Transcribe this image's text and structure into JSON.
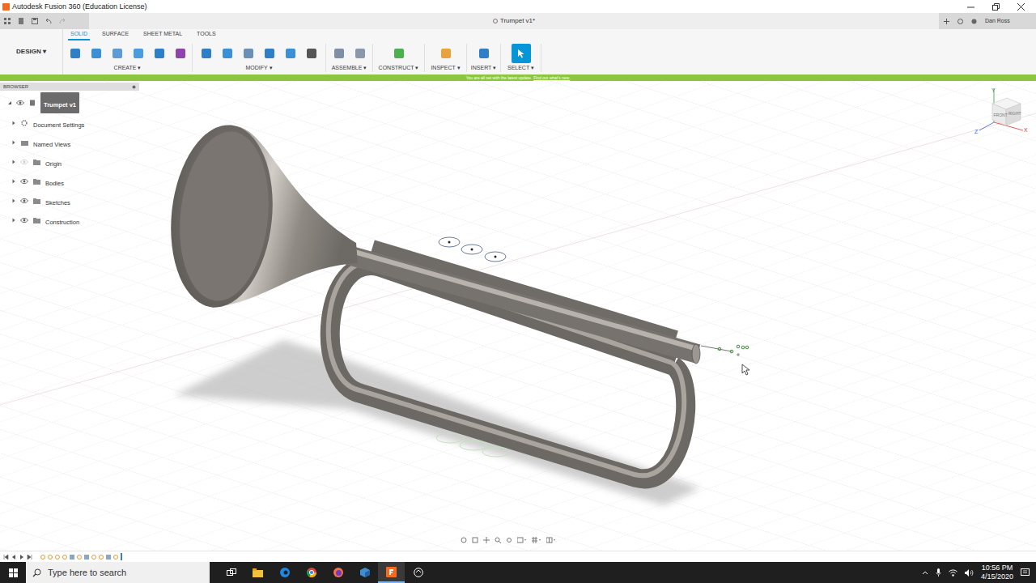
{
  "window": {
    "title": "Autodesk Fusion 360 (Education License)"
  },
  "document_tab": {
    "title": "Trumpet v1*"
  },
  "user": {
    "name": "Dan Ross"
  },
  "workspace": {
    "label": "DESIGN ▾"
  },
  "toolbar_tabs": [
    {
      "label": "SOLID",
      "selected": true
    },
    {
      "label": "SURFACE",
      "selected": false
    },
    {
      "label": "SHEET METAL",
      "selected": false
    },
    {
      "label": "TOOLS",
      "selected": false
    }
  ],
  "tool_groups": [
    {
      "label": "CREATE ▾",
      "active": false
    },
    {
      "label": "MODIFY ▾",
      "active": false
    },
    {
      "label": "ASSEMBLE ▾",
      "active": false
    },
    {
      "label": "CONSTRUCT ▾",
      "active": false
    },
    {
      "label": "INSPECT ▾",
      "active": false
    },
    {
      "label": "INSERT ▾",
      "active": false
    },
    {
      "label": "SELECT ▾",
      "active": true
    }
  ],
  "banner": {
    "text": "You are all set with the latest update.",
    "link": "Find out what's new."
  },
  "browser": {
    "title": "BROWSER",
    "items": [
      {
        "label": "Trumpet v1",
        "kind": "component",
        "expanded": true,
        "selected": true,
        "visible": true
      },
      {
        "label": "Document Settings",
        "kind": "settings",
        "expanded": false,
        "selected": false,
        "visible": true
      },
      {
        "label": "Named Views",
        "kind": "views",
        "expanded": false,
        "selected": false,
        "visible": true
      },
      {
        "label": "Origin",
        "kind": "folder",
        "expanded": false,
        "selected": false,
        "visible": false
      },
      {
        "label": "Bodies",
        "kind": "folder",
        "expanded": false,
        "selected": false,
        "visible": true
      },
      {
        "label": "Sketches",
        "kind": "folder",
        "expanded": false,
        "selected": false,
        "visible": true
      },
      {
        "label": "Construction",
        "kind": "folder",
        "expanded": false,
        "selected": false,
        "visible": true
      }
    ]
  },
  "viewcube": {
    "front": "FRONT",
    "right": "RIGHT",
    "axes": [
      {
        "label": "Z",
        "color": "#3b5bdb"
      },
      {
        "label": "X",
        "color": "#e03131"
      },
      {
        "label": "Y",
        "color": "#2f9e44"
      }
    ]
  },
  "taskbar": {
    "search_placeholder": "Type here to search",
    "time": "10:56 PM",
    "date": "4/15/2020"
  }
}
